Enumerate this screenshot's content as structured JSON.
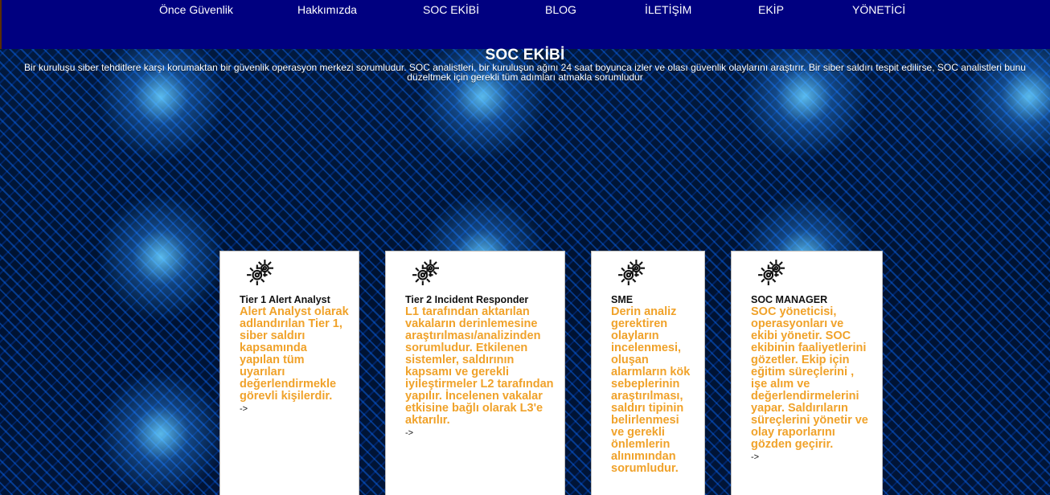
{
  "nav": {
    "items": [
      {
        "label": "Önce Güvenlik"
      },
      {
        "label": "Hakkımızda"
      },
      {
        "label": "SOC EKİBİ"
      },
      {
        "label": "BLOG"
      },
      {
        "label": "İLETİŞİM"
      },
      {
        "label": "EKİP"
      },
      {
        "label": "YÖNETİCİ"
      }
    ]
  },
  "header": {
    "title": "SOC EKİBİ",
    "description": "Bir kuruluşu siber tehditlere karşı korumaktan bir güvenlik operasyon merkezi sorumludur. SOC analistleri, bir kuruluşun ağını 24 saat boyunca izler ve olası güvenlik olaylarını araştırır. Bir siber saldırı tespit edilirse, SOC analistleri bunu düzeltmek için gerekli tüm adımları atmakla sorumludur"
  },
  "cards": [
    {
      "title": "Tier 1 Alert Analyst",
      "text": "Alert Analyst olarak adlandırılan Tier 1, siber saldırı kapsamında yapılan tüm uyarıları değerlendirmekle görevli kişilerdir.",
      "arrow": "->"
    },
    {
      "title": "Tier 2 Incident Responder",
      "text": "L1 tarafından aktarılan vakaların derinlemesine araştırılması/analizinden sorumludur. Etkilenen sistemler, saldırının kapsamı ve gerekli iyileştirmeler L2 tarafından yapılır. İncelenen vakalar etkisine bağlı olarak L3'e aktarılır.",
      "arrow": "->"
    },
    {
      "title": "SME",
      "text": "Derin analiz gerektiren olayların incelenmesi, oluşan alarmların kök sebeplerinin araştırılması, saldırı tipinin belirlenmesi ve gerekli önlemlerin alınımından sorumludur.",
      "arrow": ""
    },
    {
      "title": "SOC MANAGER",
      "text": "SOC yöneticisi, operasyonları ve ekibi yönetir. SOC ekibinin faaliyetlerini gözetler. Ekip için eğitim süreçlerini , işe alım ve değerlendirmelerini yapar. Saldırıların süreçlerini yönetir ve olay raporlarını gözden geçirir.",
      "arrow": "->"
    }
  ],
  "icons": {
    "card_icon": "gears-icon"
  },
  "colors": {
    "topbar": "#000080",
    "accent_text": "#f0a22a",
    "card_bg": "#ffffff"
  }
}
